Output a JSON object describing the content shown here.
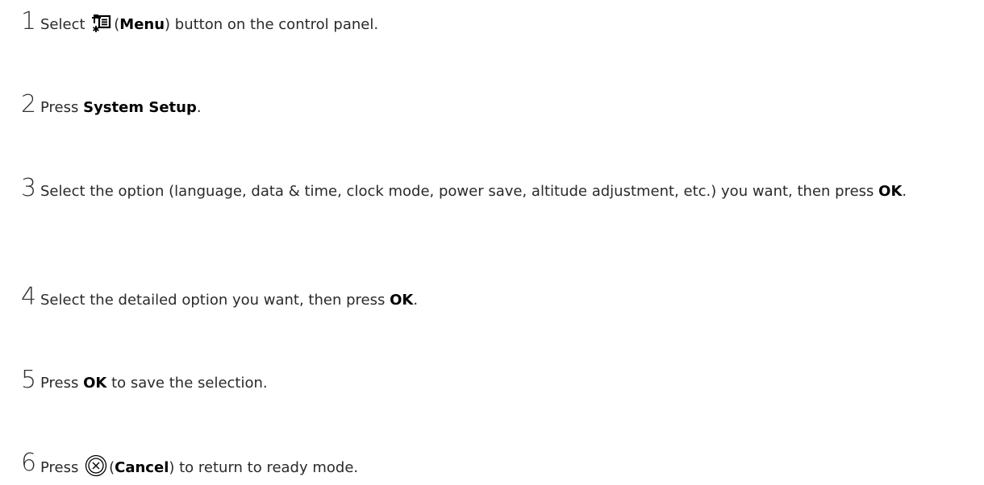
{
  "steps": [
    {
      "number": "1",
      "text_before": "Select ",
      "icon": "menu-icon",
      "paren_open": "(",
      "bold": "Menu",
      "text_after": ") button on the control panel."
    },
    {
      "number": "2",
      "text_before": "Press ",
      "bold": "System Setup",
      "text_after": "."
    },
    {
      "number": "3",
      "text_before": "Select the option (language, data & time, clock mode, power save, altitude adjustment, etc.) you want, then press ",
      "bold": "OK",
      "text_after": "."
    },
    {
      "number": "4",
      "text_before": "Select the detailed option you want, then press ",
      "bold": "OK",
      "text_after": "."
    },
    {
      "number": "5",
      "text_before": "Press ",
      "bold": "OK",
      "text_after": " to save the selection."
    },
    {
      "number": "6",
      "text_before": "Press ",
      "icon": "cancel-icon",
      "paren_open": "(",
      "bold": "Cancel",
      "text_after": ") to return to ready mode."
    }
  ]
}
